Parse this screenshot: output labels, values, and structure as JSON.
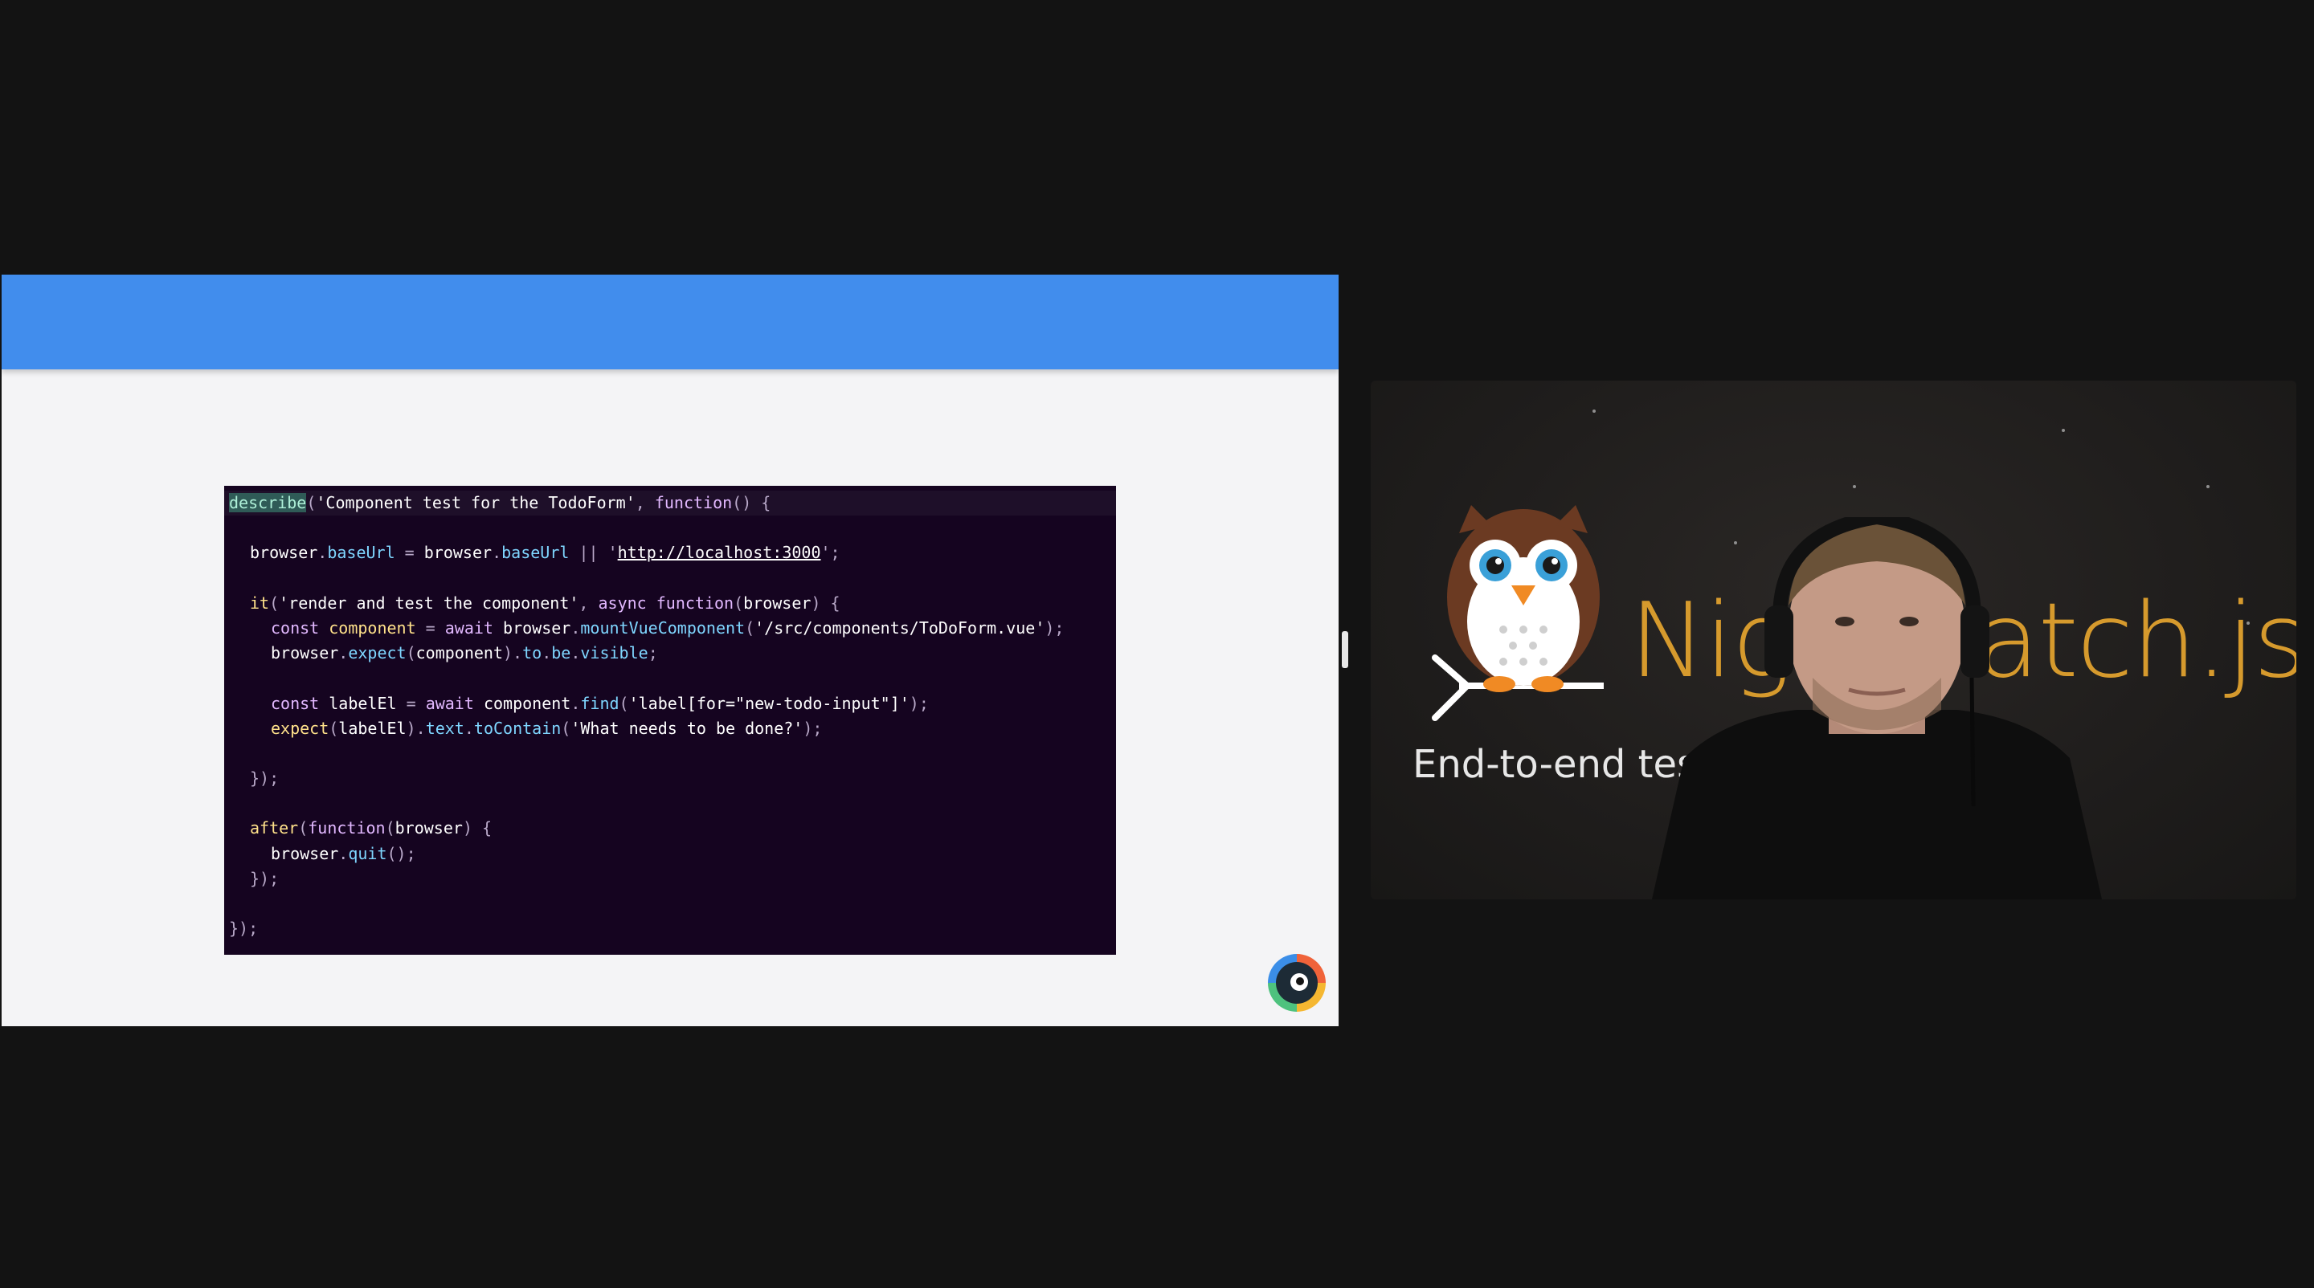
{
  "slide": {
    "code_lines": [
      {
        "indent": 0,
        "tokens": [
          {
            "t": "describe",
            "c": "hl"
          },
          {
            "t": "(",
            "c": "pun"
          },
          {
            "t": "'Component test for the TodoForm'",
            "c": "str"
          },
          {
            "t": ", ",
            "c": "pun"
          },
          {
            "t": "function",
            "c": "kw"
          },
          {
            "t": "() {",
            "c": "pun"
          }
        ]
      },
      {
        "indent": 0,
        "tokens": []
      },
      {
        "indent": 1,
        "tokens": [
          {
            "t": "browser",
            "c": "var"
          },
          {
            "t": ".",
            "c": "pun"
          },
          {
            "t": "baseUrl",
            "c": "prop"
          },
          {
            "t": " = ",
            "c": "pun"
          },
          {
            "t": "browser",
            "c": "var"
          },
          {
            "t": ".",
            "c": "pun"
          },
          {
            "t": "baseUrl",
            "c": "prop"
          },
          {
            "t": " || '",
            "c": "pun"
          },
          {
            "t": "http://localhost:3000",
            "c": "url"
          },
          {
            "t": "';",
            "c": "pun"
          }
        ]
      },
      {
        "indent": 0,
        "tokens": []
      },
      {
        "indent": 1,
        "tokens": [
          {
            "t": "it",
            "c": "fn"
          },
          {
            "t": "(",
            "c": "pun"
          },
          {
            "t": "'render and test the component'",
            "c": "str"
          },
          {
            "t": ", ",
            "c": "pun"
          },
          {
            "t": "async function",
            "c": "kw"
          },
          {
            "t": "(",
            "c": "pun"
          },
          {
            "t": "browser",
            "c": "var"
          },
          {
            "t": ") {",
            "c": "pun"
          }
        ]
      },
      {
        "indent": 2,
        "tokens": [
          {
            "t": "const",
            "c": "kw"
          },
          {
            "t": " ",
            "c": "pun"
          },
          {
            "t": "component",
            "c": "fn"
          },
          {
            "t": " = ",
            "c": "pun"
          },
          {
            "t": "await",
            "c": "kw"
          },
          {
            "t": " ",
            "c": "pun"
          },
          {
            "t": "browser",
            "c": "var"
          },
          {
            "t": ".",
            "c": "pun"
          },
          {
            "t": "mountVueComponent",
            "c": "prop"
          },
          {
            "t": "(",
            "c": "pun"
          },
          {
            "t": "'/src/components/ToDoForm.vue'",
            "c": "str"
          },
          {
            "t": ");",
            "c": "pun"
          }
        ]
      },
      {
        "indent": 2,
        "tokens": [
          {
            "t": "browser",
            "c": "var"
          },
          {
            "t": ".",
            "c": "pun"
          },
          {
            "t": "expect",
            "c": "prop"
          },
          {
            "t": "(",
            "c": "pun"
          },
          {
            "t": "component",
            "c": "var"
          },
          {
            "t": ").",
            "c": "pun"
          },
          {
            "t": "to",
            "c": "prop"
          },
          {
            "t": ".",
            "c": "pun"
          },
          {
            "t": "be",
            "c": "prop"
          },
          {
            "t": ".",
            "c": "pun"
          },
          {
            "t": "visible",
            "c": "prop"
          },
          {
            "t": ";",
            "c": "pun"
          }
        ]
      },
      {
        "indent": 0,
        "tokens": []
      },
      {
        "indent": 2,
        "tokens": [
          {
            "t": "const",
            "c": "kw"
          },
          {
            "t": " ",
            "c": "pun"
          },
          {
            "t": "labelEl",
            "c": "var"
          },
          {
            "t": " = ",
            "c": "pun"
          },
          {
            "t": "await",
            "c": "kw"
          },
          {
            "t": " ",
            "c": "pun"
          },
          {
            "t": "component",
            "c": "var"
          },
          {
            "t": ".",
            "c": "pun"
          },
          {
            "t": "find",
            "c": "prop"
          },
          {
            "t": "(",
            "c": "pun"
          },
          {
            "t": "'label[for=\"new-todo-input\"]'",
            "c": "str"
          },
          {
            "t": ");",
            "c": "pun"
          }
        ]
      },
      {
        "indent": 2,
        "tokens": [
          {
            "t": "expect",
            "c": "fn"
          },
          {
            "t": "(",
            "c": "pun"
          },
          {
            "t": "labelEl",
            "c": "var"
          },
          {
            "t": ").",
            "c": "pun"
          },
          {
            "t": "text",
            "c": "prop"
          },
          {
            "t": ".",
            "c": "pun"
          },
          {
            "t": "toContain",
            "c": "prop"
          },
          {
            "t": "(",
            "c": "pun"
          },
          {
            "t": "'What needs to be done?'",
            "c": "str"
          },
          {
            "t": ");",
            "c": "pun"
          }
        ]
      },
      {
        "indent": 0,
        "tokens": []
      },
      {
        "indent": 1,
        "tokens": [
          {
            "t": "});",
            "c": "pun"
          }
        ]
      },
      {
        "indent": 0,
        "tokens": []
      },
      {
        "indent": 1,
        "tokens": [
          {
            "t": "after",
            "c": "fn"
          },
          {
            "t": "(",
            "c": "pun"
          },
          {
            "t": "function",
            "c": "kw"
          },
          {
            "t": "(",
            "c": "pun"
          },
          {
            "t": "browser",
            "c": "var"
          },
          {
            "t": ") {",
            "c": "pun"
          }
        ]
      },
      {
        "indent": 2,
        "tokens": [
          {
            "t": "browser",
            "c": "var"
          },
          {
            "t": ".",
            "c": "pun"
          },
          {
            "t": "quit",
            "c": "prop"
          },
          {
            "t": "();",
            "c": "pun"
          }
        ]
      },
      {
        "indent": 1,
        "tokens": [
          {
            "t": "});",
            "c": "pun"
          }
        ]
      },
      {
        "indent": 0,
        "tokens": []
      },
      {
        "indent": 0,
        "tokens": [
          {
            "t": "});",
            "c": "pun"
          }
        ]
      }
    ],
    "header_color": "#418ded"
  },
  "camera": {
    "brand_text": "Nightwatch.js",
    "tagline": "End-to-end testing"
  },
  "icons": {
    "presenter_logo": "camera-eye-logo-icon",
    "owl": "nightwatch-owl-icon",
    "splitter": "drag-handle-icon"
  }
}
